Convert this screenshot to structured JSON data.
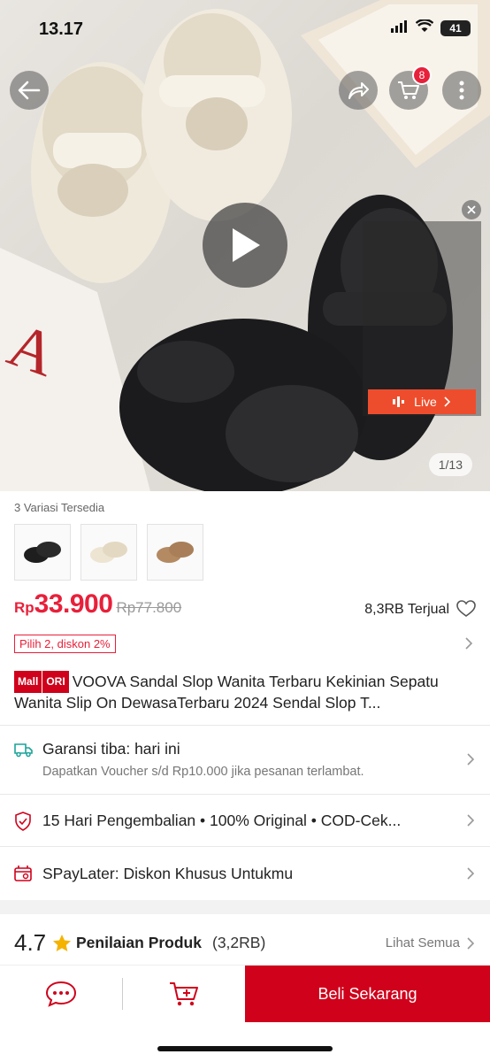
{
  "status": {
    "time": "13.17",
    "battery": "41"
  },
  "gallery": {
    "cart_count": "8",
    "live_label": "Live",
    "counter": "1/13"
  },
  "variants": {
    "label": "3 Variasi Tersedia",
    "items": [
      "black",
      "cream",
      "brown"
    ]
  },
  "price": {
    "currency": "Rp",
    "value": "33.900",
    "original": "Rp77.800",
    "sold": "8,3RB Terjual"
  },
  "promo": {
    "label": "Pilih 2, diskon 2%"
  },
  "product": {
    "badge_mall": "Mall",
    "badge_ori": "ORI",
    "title": "VOOVA Sandal Slop Wanita Terbaru Kekinian Sepatu Wanita Slip On DewasaTerbaru 2024 Sendal Slop T..."
  },
  "shipping": {
    "title": "Garansi tiba: hari ini",
    "subtitle": "Dapatkan Voucher s/d Rp10.000 jika pesanan terlambat."
  },
  "guarantees": {
    "text": "15 Hari Pengembalian  •  100% Original  •  COD-Cek..."
  },
  "paylater": {
    "text": "SPayLater: Diskon Khusus Untukmu"
  },
  "rating": {
    "score": "4.7",
    "title": "Penilaian Produk",
    "count": "(3,2RB)",
    "see_all": "Lihat Semua"
  },
  "bottom_bar": {
    "buy_label": "Beli Sekarang"
  },
  "colors": {
    "accent": "#d0011b",
    "price": "#e8203a",
    "live": "#ee4d2d",
    "star": "#f5b301"
  }
}
